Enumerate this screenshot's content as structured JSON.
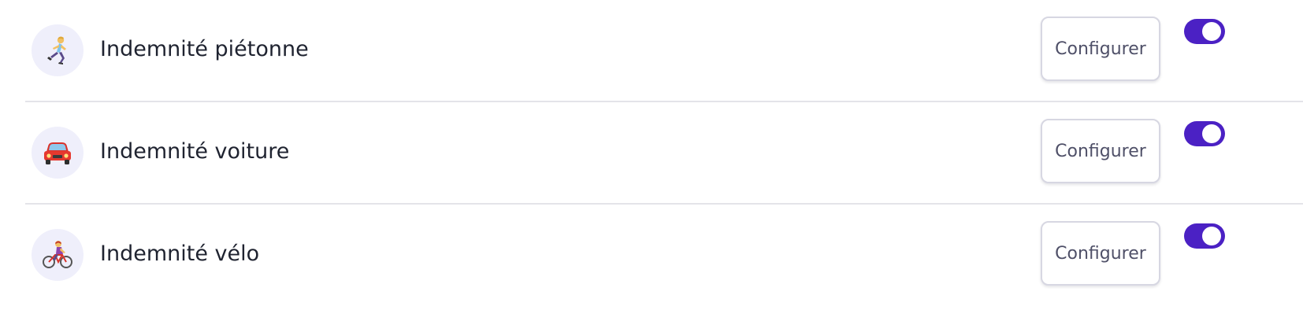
{
  "allowances": [
    {
      "label": "Indemnité piétonne",
      "icon": "running-woman-icon",
      "button_label": "Configurer",
      "enabled": true
    },
    {
      "label": "Indemnité voiture",
      "icon": "car-icon",
      "button_label": "Configurer",
      "enabled": true
    },
    {
      "label": "Indemnité vélo",
      "icon": "woman-biking-icon",
      "button_label": "Configurer",
      "enabled": true
    }
  ],
  "colors": {
    "accent": "#4b21c4",
    "avatar_bg": "#efeffb",
    "divider": "#e4e4e9"
  }
}
